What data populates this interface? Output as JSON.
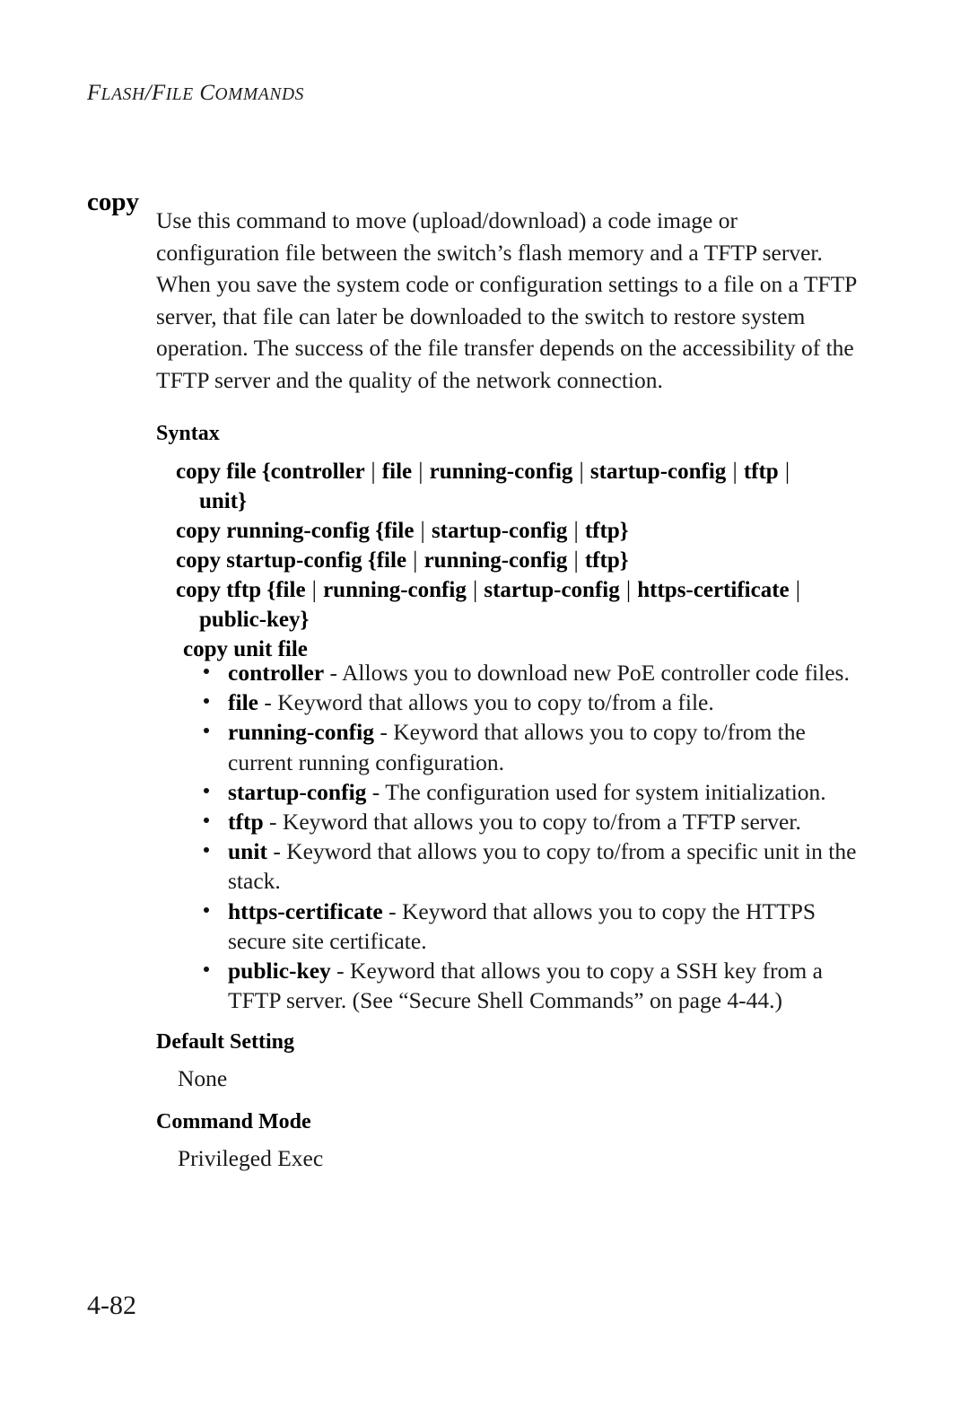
{
  "header": {
    "running_head": "FLASH/FILE COMMANDS",
    "running_head_first": "F",
    "running_head_rest_1": "LASH",
    "running_head_slash": "/F",
    "running_head_rest_2": "ILE",
    "running_head_space_c": " C",
    "running_head_rest_3": "OMMANDS"
  },
  "command": {
    "title": "copy",
    "description": {
      "line1": "Use this command to move (upload/download) a code image or",
      "line2": "configuration file between the switch’s flash memory and a TFTP server.",
      "line3": "When you save the system code or configuration settings to a file on a TFTP",
      "line4": "server, that file can later be downloaded to the switch to restore system",
      "line5": "operation. The success of the file transfer depends on the accessibility of the",
      "line6": "TFTP server and the quality of the network connection."
    }
  },
  "sections": {
    "syntax_heading": "Syntax",
    "default_setting_heading": "Default Setting",
    "default_setting_value": "None",
    "command_mode_heading": "Command Mode",
    "command_mode_value": "Privileged Exec"
  },
  "syntax": {
    "lines": [
      {
        "text": "copy file {controller | file | running-config | startup-config | tftp |",
        "indent": "normal"
      },
      {
        "text": "unit}",
        "indent": "cont"
      },
      {
        "text": "copy running-config {file | startup-config | tftp}",
        "indent": "normal"
      },
      {
        "text": "copy startup-config {file | running-config | tftp}",
        "indent": "normal"
      },
      {
        "text": "copy tftp {file | running-config | startup-config | https-certificate |",
        "indent": "normal"
      },
      {
        "text": "public-key}",
        "indent": "cont"
      },
      {
        "text": "copy unit file",
        "indent": "outdent"
      }
    ]
  },
  "keywords": [
    {
      "term": "controller",
      "sep": " - ",
      "desc_lines": [
        "Allows you to download new PoE controller code files."
      ]
    },
    {
      "term": "file",
      "sep": " - ",
      "desc_lines": [
        "Keyword that allows you to copy to/from a file."
      ]
    },
    {
      "term": "running-config",
      "sep": " - ",
      "desc_lines": [
        "Keyword that allows you to copy to/from the",
        "current running configuration."
      ]
    },
    {
      "term": "startup-config",
      "sep": " - ",
      "desc_lines": [
        "The configuration used for system initialization."
      ]
    },
    {
      "term": "tftp",
      "sep": " - ",
      "desc_lines": [
        "Keyword that allows you to copy to/from a TFTP server."
      ]
    },
    {
      "term": "unit",
      "sep": " - ",
      "desc_lines": [
        "Keyword that allows you to copy to/from a specific unit in the",
        "stack."
      ]
    },
    {
      "term": "https-certificate",
      "sep": " - ",
      "desc_lines": [
        "Keyword that allows you to copy the HTTPS",
        "secure site certificate."
      ]
    },
    {
      "term": "public-key",
      "sep": " - ",
      "desc_lines": [
        "Keyword that allows you to copy a SSH key from a",
        "TFTP server. (See “Secure Shell Commands” on page 4-44.)"
      ]
    }
  ],
  "footer": {
    "page_number": "4-82"
  }
}
